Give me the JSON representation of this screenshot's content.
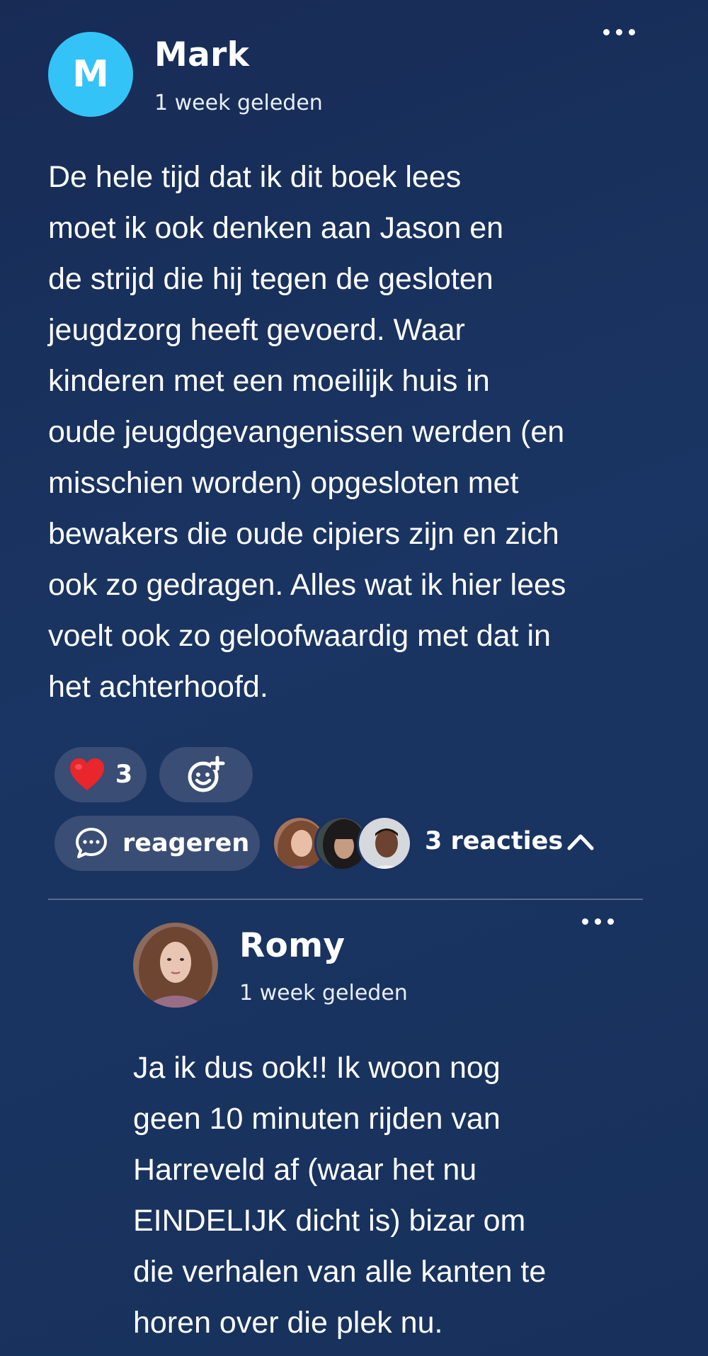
{
  "comment": {
    "avatar_initial": "M",
    "author": "Mark",
    "time": "1 week geleden",
    "body": "De hele tijd dat ik dit boek lees\nmoet ik ook denken aan Jason en\nde strijd die hij tegen de gesloten\njeugdzorg heeft gevoerd. Waar\nkinderen met een moeilijk huis in\noude jeugdgevangenissen werden (en\nmisschien worden) opgesloten met\nbewakers die oude cipiers zijn en zich\nook zo gedragen. Alles wat ik hier lees\nvoelt ook zo geloofwaardig met dat in\nhet achterhoofd.",
    "like_count": "3",
    "reply_label": "reageren",
    "reactions_label": "3 reacties",
    "accent_color": "#33c3f7"
  },
  "reply": {
    "author": "Romy",
    "time": "1 week geleden",
    "body": "Ja ik dus ook!! Ik woon nog\ngeen 10 minuten rijden van\nHarreveld af (waar het nu\nEINDELIJK dicht is) bizar om\ndie verhalen van alle kanten te\nhoren over die plek nu."
  },
  "icons": {
    "more": "more-dots-icon",
    "heart": "heart-icon",
    "add_reaction": "add-emoji-icon",
    "chat": "chat-bubble-icon",
    "chevron": "chevron-up-icon"
  }
}
